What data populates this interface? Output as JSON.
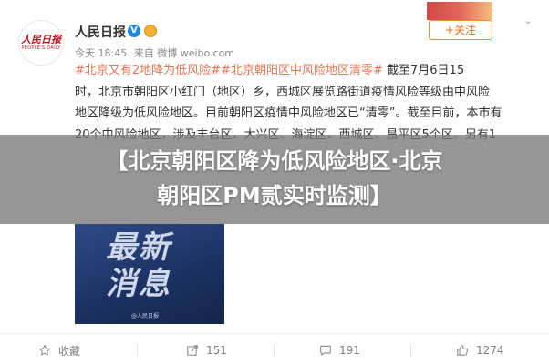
{
  "post": {
    "author": {
      "name": "人民日报",
      "logo_text": "人民日报",
      "logo_subtext": "PEOPLE'S DAILY",
      "verified_icon": "verified-v-icon",
      "badge_icon": "medal-icon"
    },
    "meta": {
      "time": "今天 18:45",
      "source": "来自 微博 weibo.com"
    },
    "follow_label": "+关注",
    "chevron": "⌄",
    "text": {
      "hashtag1": "#北京又有2地降为低风险#",
      "hashtag2": "#北京朝阳区中风险地区清零#",
      "line1_tail": "截至7月6日15",
      "line2": "时，北京市朝阳区小红门（地区）乡，西城区展览路街道疫情风险等级由中风险",
      "line3": "地区降级为低风险地区。目前朝阳区疫情中风险地区已“清零”。截至目前，本市有",
      "line4": "20个中风险地区，涉及丰台区、大兴区、海淀区、西城区、昌平区5个区。另有1"
    },
    "image": {
      "big_text_1": "最新",
      "big_text_2": "消息",
      "watermark": "@人民日报"
    },
    "actions": {
      "favorite": "收藏",
      "share": "151",
      "comment": "191",
      "like": "1274"
    }
  },
  "overlay": {
    "headline_line1": "【北京朝阳区降为低风险地区·北京",
    "headline_line2": "朝阳区PM贰⁠实时监测】"
  },
  "colors": {
    "accent_orange": "#eb7350",
    "follow_border": "#f18c2c",
    "logo_red": "#c4161c",
    "verified_blue": "#1e88e5",
    "overlay_band": "rgba(120,120,120,0.78)"
  }
}
